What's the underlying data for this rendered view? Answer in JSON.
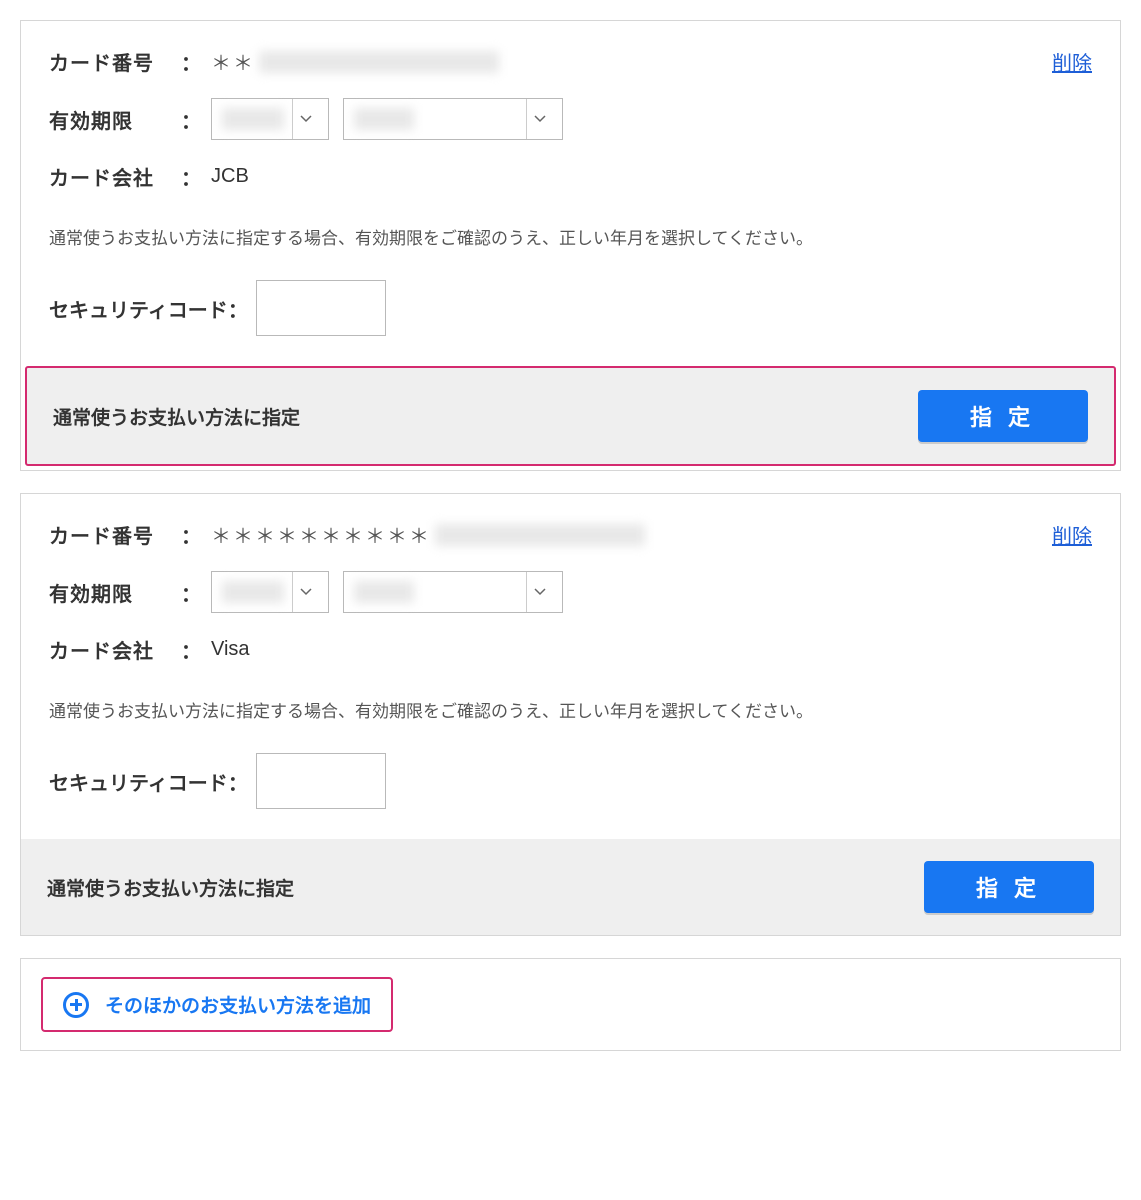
{
  "labels": {
    "card_number": "カード番号",
    "expiry": "有効期限",
    "company": "カード会社",
    "delete": "削除",
    "note": "通常使うお支払い方法に指定する場合、有効期限をご確認のうえ、正しい年月を選択してください。",
    "security_code": "セキュリティコード",
    "footer_label": "通常使うお支払い方法に指定",
    "assign": "指定",
    "add_other": "そのほかのお支払い方法を追加"
  },
  "cards": [
    {
      "number_mask": "＊＊",
      "company": "JCB",
      "highlighted": true
    },
    {
      "number_mask": "＊＊＊＊＊＊＊＊＊＊",
      "company": "Visa",
      "highlighted": false
    }
  ]
}
